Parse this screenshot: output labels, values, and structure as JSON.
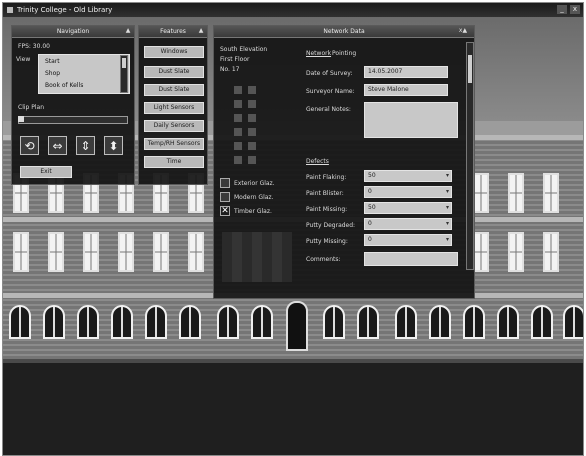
{
  "window": {
    "title": "Trinity College - Old Library",
    "minimize": "_",
    "close": "x"
  },
  "navigation": {
    "header": "Navigation",
    "collapse": "▲",
    "fps": "FPS: 30.00",
    "view_label": "View",
    "view_options": [
      "Start",
      "Shop",
      "Book of Kells"
    ],
    "clip_label": "Clip Plan",
    "exit_label": "Exit",
    "icons": [
      "rotate-icon",
      "pan-horizontal-icon",
      "pan-vertical-icon",
      "zoom-icon"
    ]
  },
  "features": {
    "header": "Features",
    "collapse": "▲",
    "buttons": [
      "Windows",
      "Dust Slate",
      "Dust Slate",
      "Light Sensors",
      "Daily Sensors",
      "Temp/RH Sensors",
      "Time"
    ]
  },
  "network": {
    "header": "Network Data",
    "controls": "x▲",
    "location": [
      "South Elevation",
      "First Floor",
      "No. 17"
    ],
    "tabs": [
      "Network",
      "Pointing"
    ],
    "date_label": "Date of Survey:",
    "date_value": "14.05.2007",
    "surveyor_label": "Surveyor Name:",
    "surveyor_value": "Steve Malone",
    "notes_label": "General Notes:",
    "notes_value": "",
    "section_heading": "Defects",
    "fields": [
      {
        "label": "Paint Flaking:",
        "value": "50"
      },
      {
        "label": "Paint Blister:",
        "value": "0"
      },
      {
        "label": "Paint Missing:",
        "value": "50"
      },
      {
        "label": "Putty Degraded:",
        "value": "0"
      },
      {
        "label": "Putty Missing:",
        "value": "0"
      },
      {
        "label": "Comments:",
        "value": ""
      }
    ],
    "status": [
      {
        "label": "Exterior Glaz.",
        "checked": false
      },
      {
        "label": "Modern Glaz.",
        "checked": false
      },
      {
        "label": "Timber Glaz.",
        "checked": true
      }
    ]
  },
  "colors": {
    "panel": "#141414",
    "button": "#b9b9b9",
    "field": "#c8c8c8"
  }
}
